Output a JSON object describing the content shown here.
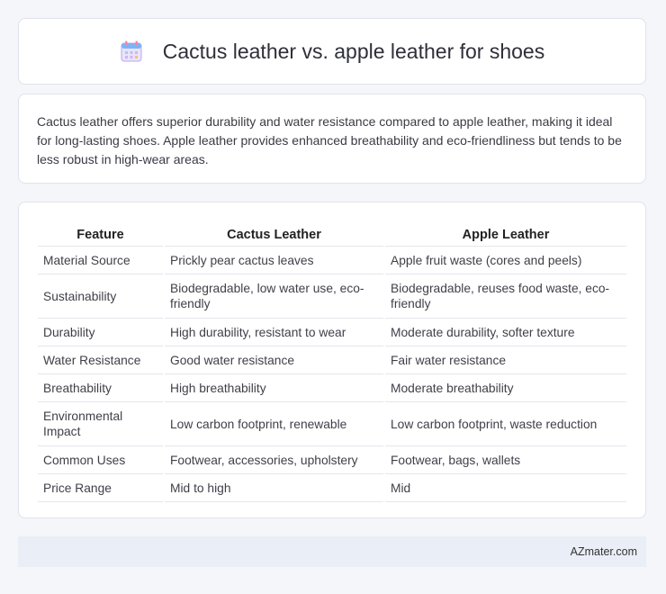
{
  "header": {
    "title": "Cactus leather vs. apple leather for shoes",
    "icon": "calendar-icon"
  },
  "summary": {
    "text": "Cactus leather offers superior durability and water resistance compared to apple leather, making it ideal for long-lasting shoes. Apple leather provides enhanced breathability and eco-friendliness but tends to be less robust in high-wear areas."
  },
  "table": {
    "headers": [
      "Feature",
      "Cactus Leather",
      "Apple Leather"
    ],
    "rows": [
      [
        "Material Source",
        "Prickly pear cactus leaves",
        "Apple fruit waste (cores and peels)"
      ],
      [
        "Sustainability",
        "Biodegradable, low water use, eco-friendly",
        "Biodegradable, reuses food waste, eco-friendly"
      ],
      [
        "Durability",
        "High durability, resistant to wear",
        "Moderate durability, softer texture"
      ],
      [
        "Water Resistance",
        "Good water resistance",
        "Fair water resistance"
      ],
      [
        "Breathability",
        "High breathability",
        "Moderate breathability"
      ],
      [
        "Environmental Impact",
        "Low carbon footprint, renewable",
        "Low carbon footprint, waste reduction"
      ],
      [
        "Common Uses",
        "Footwear, accessories, upholstery",
        "Footwear, bags, wallets"
      ],
      [
        "Price Range",
        "Mid to high",
        "Mid"
      ]
    ]
  },
  "footer": {
    "brand": "AZmater.com"
  },
  "colors": {
    "background": "#f4f6f9",
    "card": "#ffffff",
    "footer": "#e9eef7"
  }
}
